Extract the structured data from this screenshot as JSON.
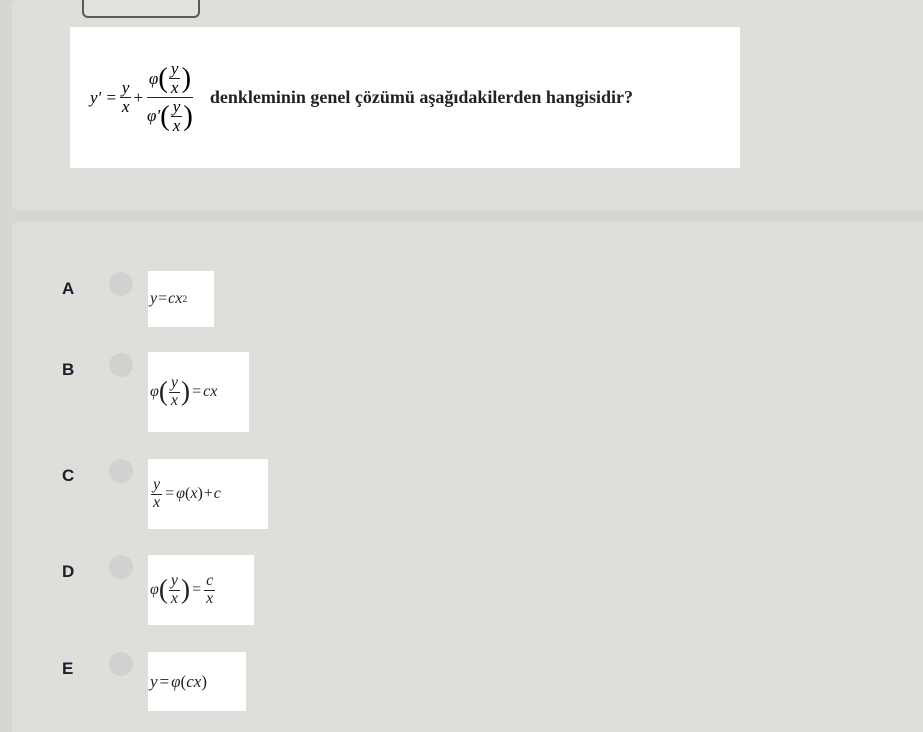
{
  "question": {
    "statement_text": "denkleminin genel çözümü aşağıdakilerden hangisidir?",
    "eq_lhs": "y' =",
    "eq_y": "y",
    "eq_x": "x",
    "eq_plus": "+",
    "eq_phi": "φ",
    "eq_phi_prime": "φ'"
  },
  "options": [
    {
      "letter": "A",
      "formula": "y = cx²"
    },
    {
      "letter": "B",
      "formula": "φ(y/x) = cx"
    },
    {
      "letter": "C",
      "formula": "y/x = φ(x) + c"
    },
    {
      "letter": "D",
      "formula": "φ(y/x) = c/x"
    },
    {
      "letter": "E",
      "formula": "y = φ(cx)"
    }
  ],
  "symbols": {
    "y": "y",
    "x": "x",
    "c": "c",
    "phi": "φ",
    "eq": "=",
    "plus": "+",
    "two": "2",
    "cx": "cx"
  }
}
